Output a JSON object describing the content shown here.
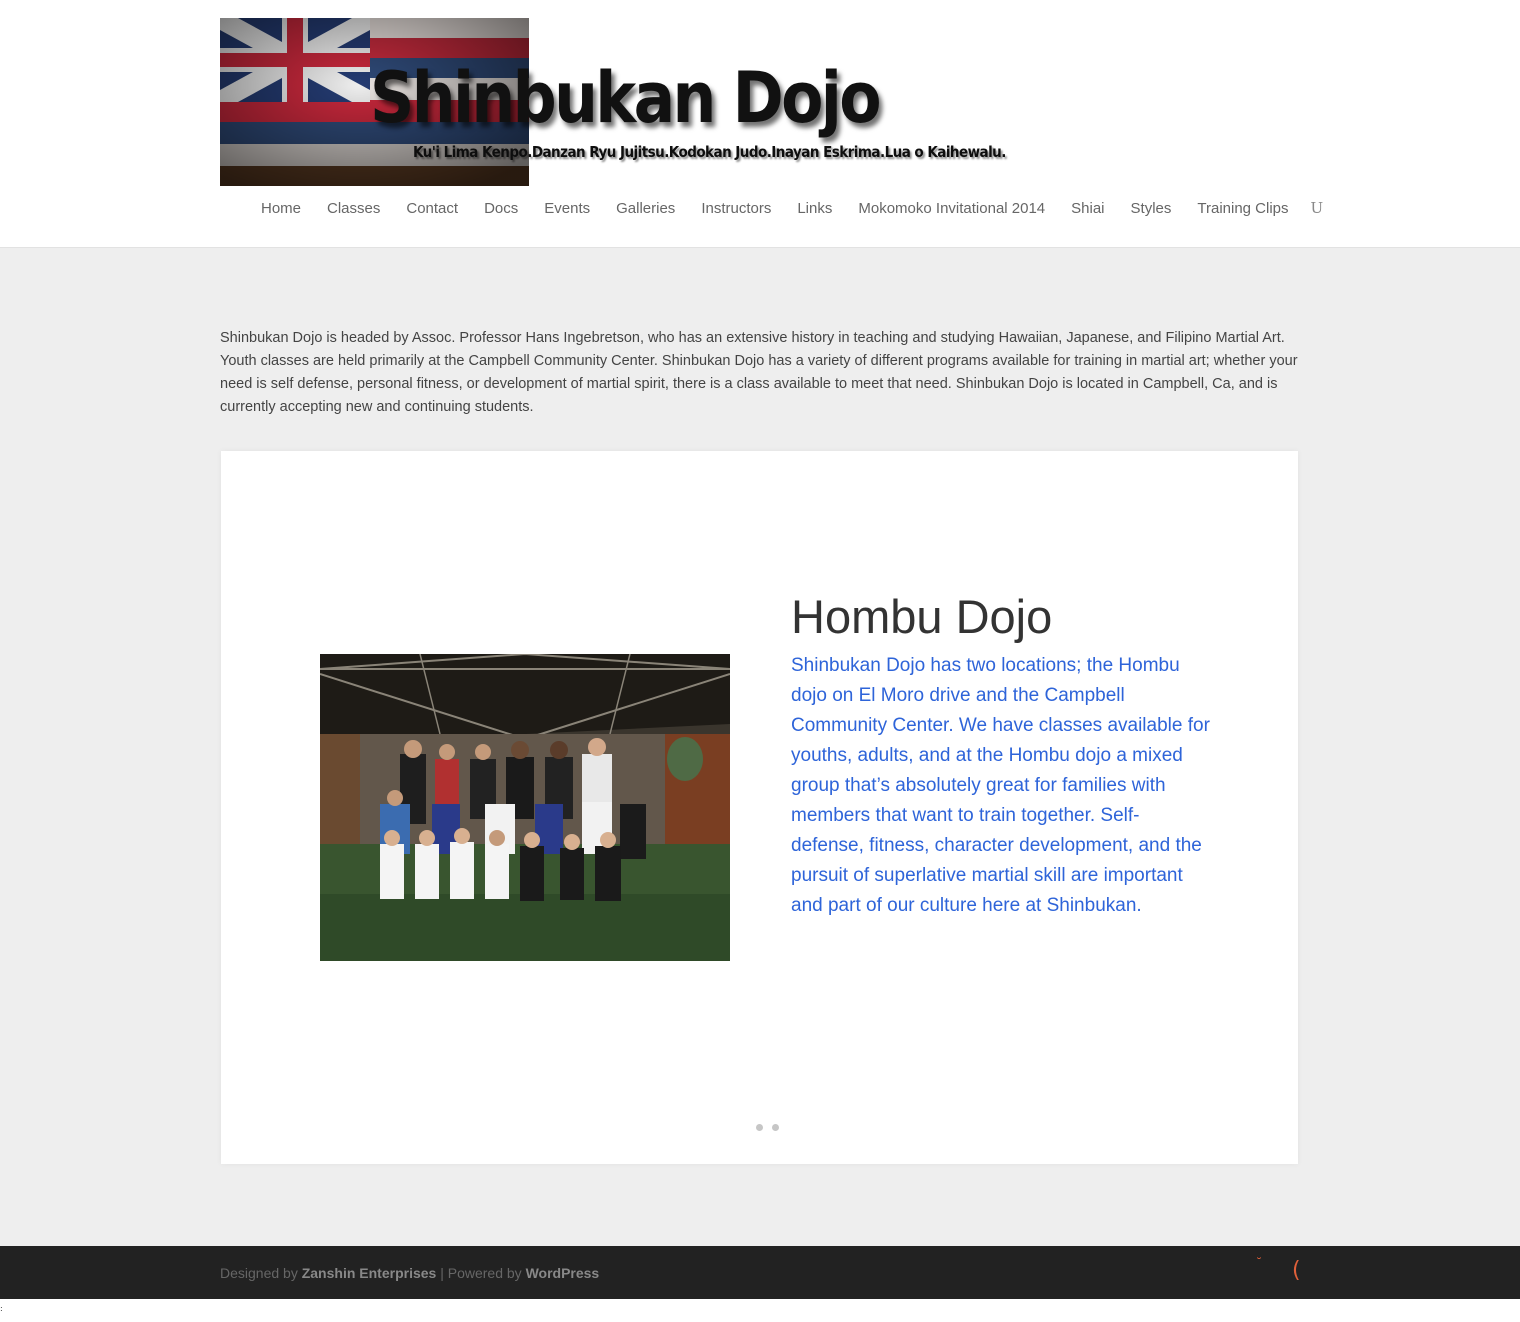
{
  "brand": {
    "title": "Shinbukan Dojo",
    "tagline": "Ku'i Lima Kenpo.Danzan Ryu Jujitsu.Kodokan Judo.Inayan Eskrima.Lua o Kaihewalu."
  },
  "nav": {
    "items": [
      "Home",
      "Classes",
      "Contact",
      "Docs",
      "Events",
      "Galleries",
      "Instructors",
      "Links",
      "Mokomoko Invitational 2014",
      "Shiai",
      "Styles",
      "Training Clips"
    ],
    "overflow_glyph": "U"
  },
  "intro": "Shinbukan Dojo is headed by Assoc. Professor Hans Ingebretson, who has an extensive history in teaching and studying Hawaiian, Japanese, and Filipino Martial Art. Youth classes are held primarily at the Campbell Community Center. Shinbukan Dojo has a variety of different programs available for training in martial art; whether your need is self defense, personal fitness, or development of martial spirit, there is a class available to meet that need. Shinbukan Dojo is located in Campbell, Ca, and is currently accepting new and continuing students.",
  "slider": {
    "title": "Hombu Dojo",
    "text": "Shinbukan Dojo has two locations; the Hombu dojo on El Moro drive and the Campbell Community Center. We have classes available for youths, adults, and at the Hombu dojo a mixed group that’s absolutely great for families with members that want to train together. Self-defense, fitness, character development, and the pursuit of superlative martial skill are important and part of our culture here at Shinbukan.",
    "slide_count": 2
  },
  "footer": {
    "designed_by_prefix": "Designed by",
    "designer": "Zanshin Enterprises",
    "separator": "| Powered by",
    "platform": "WordPress",
    "social_icon_1": "˘",
    "social_icon_2": "("
  },
  "colors": {
    "accent_link": "#2e64d9",
    "footer_bg": "#222222",
    "main_bg": "#eeeeee",
    "social_icon": "#e0603a"
  },
  "corner_mark": ":"
}
